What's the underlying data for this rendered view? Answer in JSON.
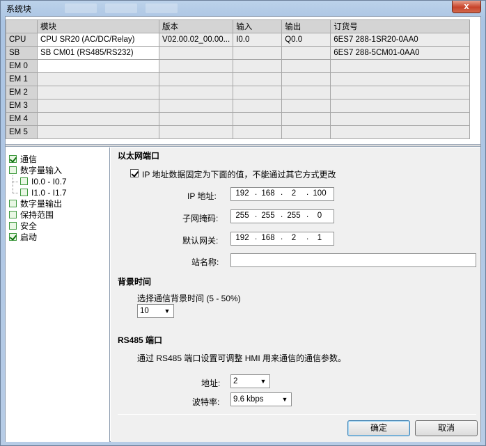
{
  "window": {
    "title": "系统块",
    "close_glyph": "x"
  },
  "module_table": {
    "columns": [
      "",
      "模块",
      "版本",
      "输入",
      "输出",
      "订货号"
    ],
    "rows": [
      {
        "slot": "CPU",
        "module": "CPU SR20 (AC/DC/Relay)",
        "version": "V02.00.02_00.00...",
        "input": "I0.0",
        "output": "Q0.0",
        "order": "6ES7 288-1SR20-0AA0"
      },
      {
        "slot": "SB",
        "module": "SB CM01 (RS485/RS232)",
        "version": "",
        "input": "",
        "output": "",
        "order": "6ES7 288-5CM01-0AA0"
      },
      {
        "slot": "EM 0",
        "module": "",
        "version": "",
        "input": "",
        "output": "",
        "order": ""
      },
      {
        "slot": "EM 1",
        "module": "",
        "version": "",
        "input": "",
        "output": "",
        "order": ""
      },
      {
        "slot": "EM 2",
        "module": "",
        "version": "",
        "input": "",
        "output": "",
        "order": ""
      },
      {
        "slot": "EM 3",
        "module": "",
        "version": "",
        "input": "",
        "output": "",
        "order": ""
      },
      {
        "slot": "EM 4",
        "module": "",
        "version": "",
        "input": "",
        "output": "",
        "order": ""
      },
      {
        "slot": "EM 5",
        "module": "",
        "version": "",
        "input": "",
        "output": "",
        "order": ""
      }
    ]
  },
  "tree": {
    "items": [
      {
        "label": "通信",
        "checked": true
      },
      {
        "label": "数字量输入",
        "checked": false
      },
      {
        "label": "I0.0 - I0.7",
        "checked": false
      },
      {
        "label": "I1.0 - I1.7",
        "checked": false
      },
      {
        "label": "数字量输出",
        "checked": false
      },
      {
        "label": "保持范围",
        "checked": false
      },
      {
        "label": "安全",
        "checked": false
      },
      {
        "label": "启动",
        "checked": true
      }
    ]
  },
  "ethernet": {
    "heading": "以太网端口",
    "fixed_ip_label": "IP 地址数据固定为下面的值，不能通过其它方式更改",
    "fixed_ip_checked": true,
    "ip_label": "IP 地址:",
    "ip": [
      "192",
      "168",
      "2",
      "100"
    ],
    "mask_label": "子网掩码:",
    "mask": [
      "255",
      "255",
      "255",
      "0"
    ],
    "gateway_label": "默认网关:",
    "gateway": [
      "192",
      "168",
      "2",
      "1"
    ],
    "station_label": "站名称:",
    "station_value": ""
  },
  "background_time": {
    "heading": "背景时间",
    "label": "选择通信背景时间 (5 - 50%)",
    "value": "10"
  },
  "rs485": {
    "heading": "RS485 端口",
    "description": "通过 RS485 端口设置可调整 HMI 用来通信的通信参数。",
    "address_label": "地址:",
    "address_value": "2",
    "baud_label": "波特率:",
    "baud_value": "9.6 kbps"
  },
  "buttons": {
    "ok": "确定",
    "cancel": "取消"
  }
}
